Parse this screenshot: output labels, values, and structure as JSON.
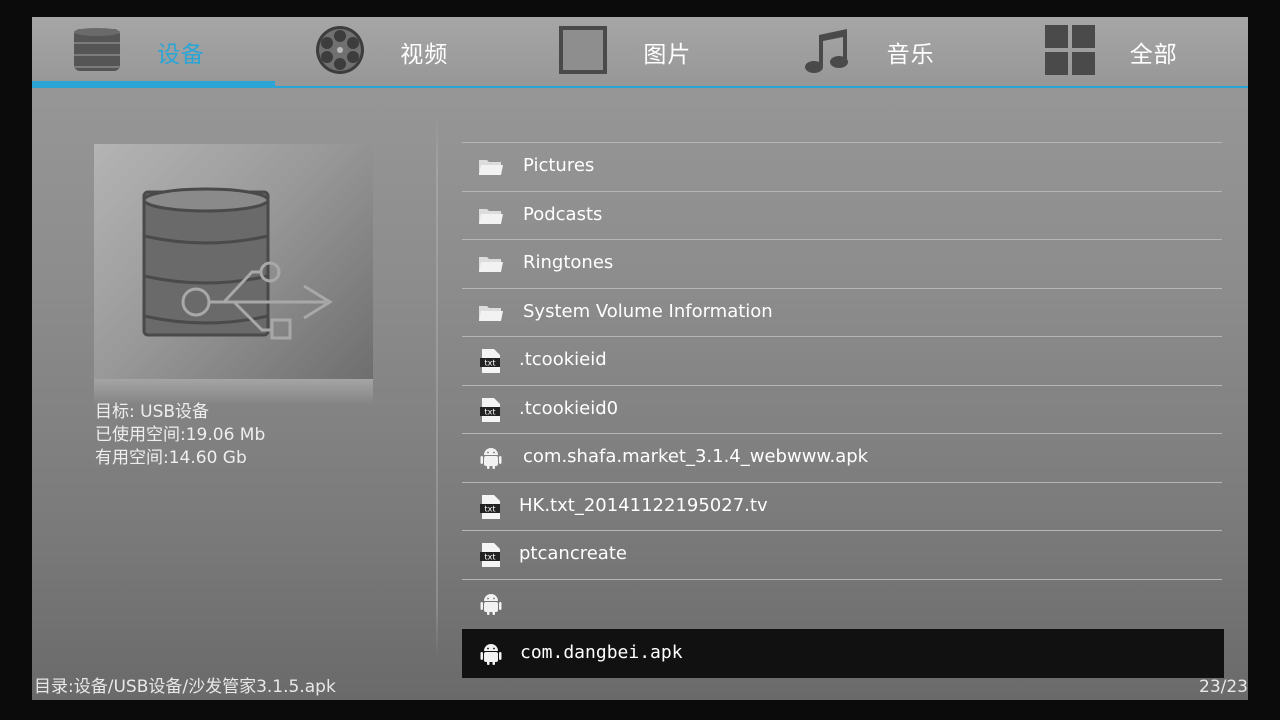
{
  "tabs": [
    {
      "label": "设备",
      "icon": "storage-icon",
      "active": true
    },
    {
      "label": "视频",
      "icon": "film-reel-icon",
      "active": false
    },
    {
      "label": "图片",
      "icon": "picture-frame-icon",
      "active": false
    },
    {
      "label": "音乐",
      "icon": "music-note-icon",
      "active": false
    },
    {
      "label": "全部",
      "icon": "grid-icon",
      "active": false
    }
  ],
  "device": {
    "image_icon": "usb-storage-icon",
    "target": "目标: USB设备",
    "used": "已使用空间:19.06 Mb",
    "free": "有用空间:14.60 Gb"
  },
  "files": [
    {
      "name": "Pictures",
      "type": "folder",
      "icon": "folder-icon"
    },
    {
      "name": "Podcasts",
      "type": "folder",
      "icon": "folder-icon"
    },
    {
      "name": "Ringtones",
      "type": "folder",
      "icon": "folder-icon"
    },
    {
      "name": "System Volume Information",
      "type": "folder",
      "icon": "folder-icon"
    },
    {
      "name": ".tcookieid",
      "type": "txt",
      "icon": "txt-file-icon"
    },
    {
      "name": ".tcookieid0",
      "type": "txt",
      "icon": "txt-file-icon"
    },
    {
      "name": "com.shafa.market_3.1.4_webwww.apk",
      "type": "apk",
      "icon": "android-icon"
    },
    {
      "name": "HK.txt_20141122195027.tv",
      "type": "txt",
      "icon": "txt-file-icon"
    },
    {
      "name": "ptcancreate",
      "type": "txt",
      "icon": "txt-file-icon"
    },
    {
      "name": "",
      "type": "apk",
      "icon": "android-icon"
    },
    {
      "name": "com.dangbei.apk",
      "type": "apk",
      "icon": "android-icon",
      "selected": true
    }
  ],
  "status": {
    "path": "目录:设备/USB设备/沙发管家3.1.5.apk",
    "count": "23/23"
  },
  "colors": {
    "accent": "#2aa5d6",
    "selected_row": "#111111"
  }
}
